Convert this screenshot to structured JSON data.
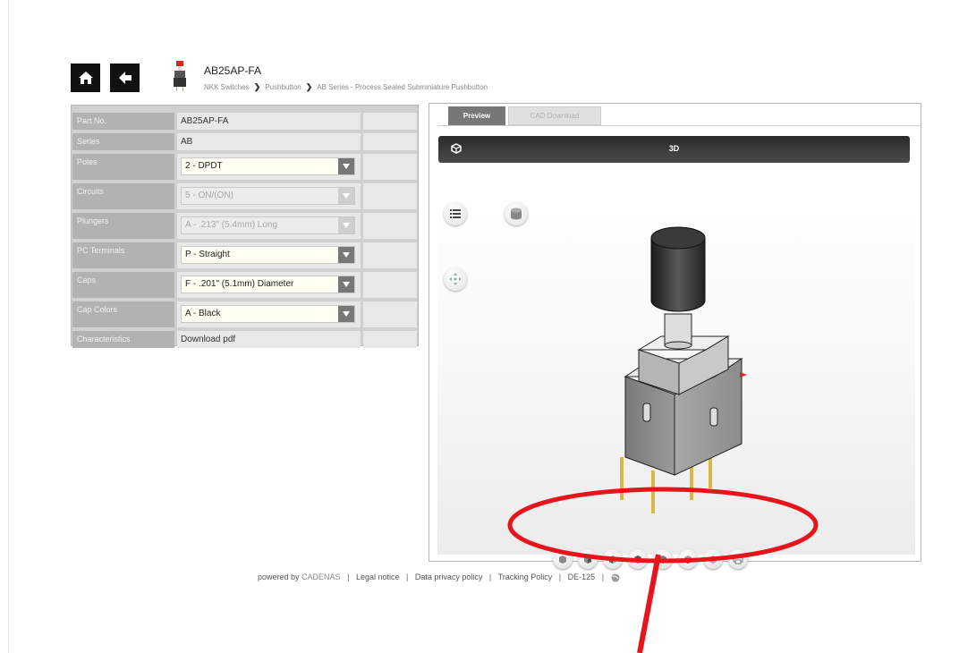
{
  "header": {
    "title": "AB25AP-FA",
    "breadcrumb": [
      "NKK Switches",
      "Pushbutton",
      "AB Series - Process Sealed Subminiature Pushbutton"
    ],
    "home_icon": "home-icon",
    "back_icon": "arrow-left-icon"
  },
  "params": {
    "rows": [
      {
        "label": "Part No.",
        "value": "AB25AP-FA"
      },
      {
        "label": "Series",
        "value": "AB"
      },
      {
        "label": "Poles",
        "value": "2 - DPDT",
        "select": true
      },
      {
        "label": "Circuits",
        "value": "5 - ON/(ON)",
        "select": true,
        "disabled": true
      },
      {
        "label": "Plungers",
        "value": "A - .213\" (5.4mm) Long",
        "select": true,
        "disabled": true
      },
      {
        "label": "PC Terminals",
        "value": "P - Straight",
        "select": true
      },
      {
        "label": "Caps",
        "value": "F - .201\" (5.1mm) Diameter",
        "select": true
      },
      {
        "label": "Cap Colors",
        "value": "A - Black",
        "select": true
      },
      {
        "label": "Characteristics",
        "value": "Download pdf"
      }
    ]
  },
  "preview": {
    "tabs": [
      "Preview",
      "CAD Download"
    ],
    "active_tab": "Preview",
    "view_label": "3D",
    "view_buttons": [
      "view-iso-front-icon",
      "view-front-icon",
      "view-left-icon",
      "view-top-icon",
      "view-right-icon",
      "view-back-icon",
      "view-bottom-icon",
      "print-icon"
    ]
  },
  "footer": {
    "powered_by": "powered by",
    "cadenas": "CADENAS",
    "links": [
      "Legal notice",
      "Data privacy policy",
      "Tracking Policy",
      "DE-125"
    ]
  },
  "colors": {
    "annotation": "#e8141b",
    "header_bg": "#111111",
    "label_bg": "#b2b2b2"
  }
}
